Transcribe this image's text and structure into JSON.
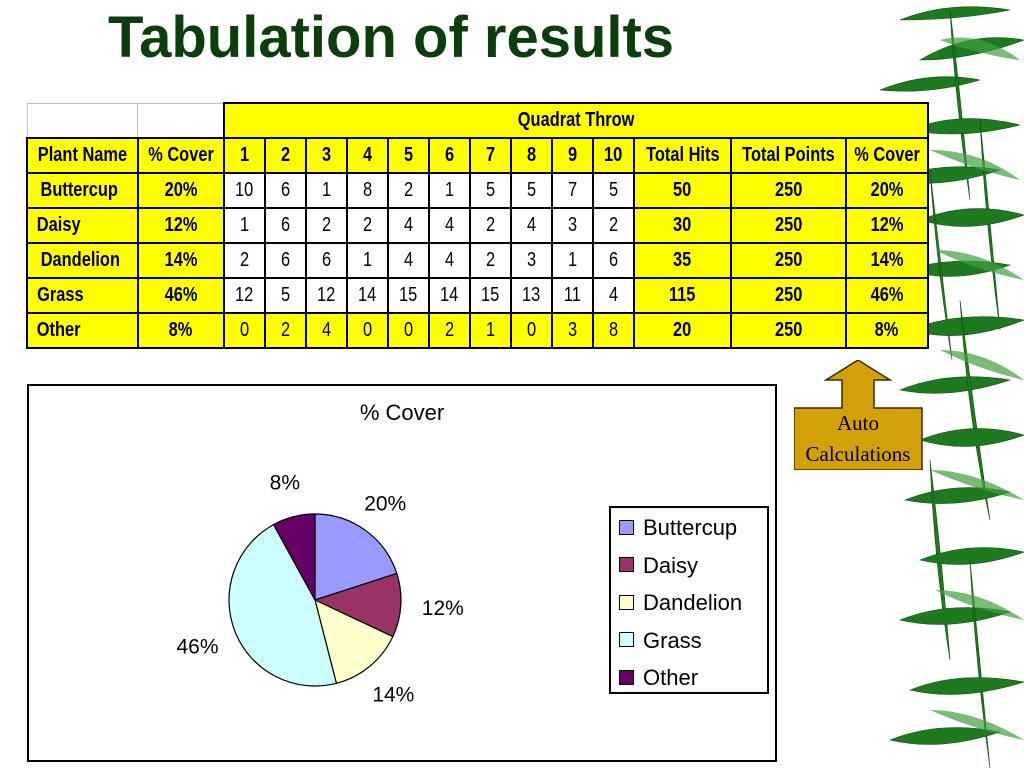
{
  "slide": {
    "title": "Tabulation of results"
  },
  "table": {
    "group_header": "Quadrat Throw",
    "headers": [
      "Plant Name",
      "% Cover",
      "1",
      "2",
      "3",
      "4",
      "5",
      "6",
      "7",
      "8",
      "9",
      "10",
      "Total Hits",
      "Total Points",
      "% Cover"
    ],
    "rows": [
      {
        "name": "Buttercup",
        "cover": "20%",
        "throws": [
          "10",
          "6",
          "1",
          "8",
          "2",
          "1",
          "5",
          "5",
          "7",
          "5"
        ],
        "total_hits": "50",
        "total_points": "250",
        "cover_calc": "20%"
      },
      {
        "name": "Daisy",
        "cover": "12%",
        "throws": [
          "1",
          "6",
          "2",
          "2",
          "4",
          "4",
          "2",
          "4",
          "3",
          "2"
        ],
        "total_hits": "30",
        "total_points": "250",
        "cover_calc": "12%"
      },
      {
        "name": "Dandelion",
        "cover": "14%",
        "throws": [
          "2",
          "6",
          "6",
          "1",
          "4",
          "4",
          "2",
          "3",
          "1",
          "6"
        ],
        "total_hits": "35",
        "total_points": "250",
        "cover_calc": "14%"
      },
      {
        "name": "Grass",
        "cover": "46%",
        "throws": [
          "12",
          "5",
          "12",
          "14",
          "15",
          "14",
          "15",
          "13",
          "11",
          "4"
        ],
        "total_hits": "115",
        "total_points": "250",
        "cover_calc": "46%"
      },
      {
        "name": "Other",
        "cover": "8%",
        "throws": [
          "0",
          "2",
          "4",
          "0",
          "0",
          "2",
          "1",
          "0",
          "3",
          "8"
        ],
        "total_hits": "20",
        "total_points": "250",
        "cover_calc": "8%"
      }
    ]
  },
  "callout": {
    "line1": "Auto",
    "line2": "Calculations",
    "color": "#d4a00a"
  },
  "chart_data": {
    "type": "pie",
    "title": "% Cover",
    "categories": [
      "Buttercup",
      "Daisy",
      "Dandelion",
      "Grass",
      "Other"
    ],
    "values": [
      20,
      12,
      14,
      46,
      8
    ],
    "labels": [
      "20%",
      "12%",
      "14%",
      "46%",
      "8%"
    ],
    "colors": [
      "#9999ff",
      "#993366",
      "#ffffcc",
      "#ccffff",
      "#660066"
    ],
    "legend": "right"
  }
}
